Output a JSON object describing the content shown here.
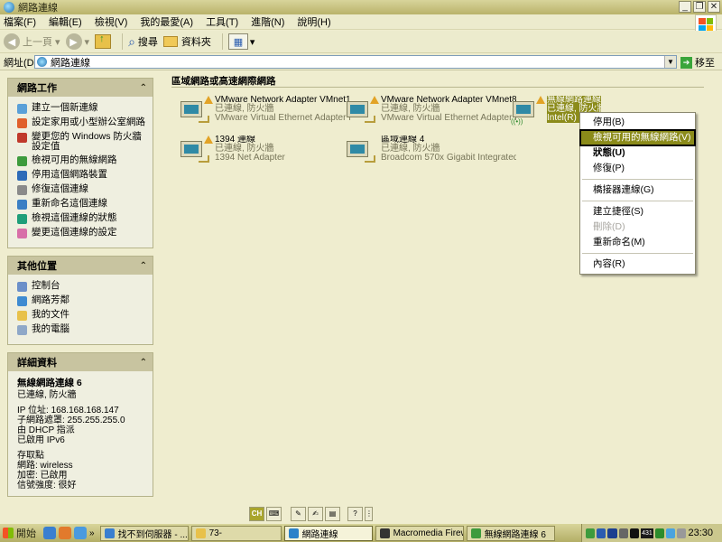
{
  "window": {
    "title": "網路連線",
    "controls": [
      "_",
      "❐",
      "✕"
    ]
  },
  "menu": [
    "檔案(F)",
    "編輯(E)",
    "檢視(V)",
    "我的最愛(A)",
    "工具(T)",
    "進階(N)",
    "說明(H)"
  ],
  "toolbar": {
    "back": "上一頁",
    "search": "搜尋",
    "folders": "資料夾"
  },
  "address": {
    "label": "網址(D)",
    "value": "網路連線",
    "go": "移至"
  },
  "network_tasks": {
    "title": "網路工作",
    "items": [
      "建立一個新連線",
      "設定家用或小型辦公室網路",
      "變更您的 Windows 防火牆設定值",
      "檢視可用的無線網路",
      "停用這個網路裝置",
      "修復這個連線",
      "重新命名這個連線",
      "檢視這個連線的狀態",
      "變更這個連線的設定"
    ]
  },
  "other_places": {
    "title": "其他位置",
    "items": [
      "控制台",
      "網路芳鄰",
      "我的文件",
      "我的電腦"
    ]
  },
  "details": {
    "title": "詳細資料",
    "name": "無線網路連線 6",
    "status": "已連線, 防火牆",
    "ip": "IP 位址: 168.168.168.147",
    "mask": "子網路遮罩: 255.255.255.0",
    "dhcp": "由 DHCP 指派",
    "ipv6": "已啟用 IPv6",
    "ap": "存取點",
    "network": "網路: wireless",
    "encryption": "加密: 已啟用",
    "signal": "信號強度: 很好"
  },
  "group_title": "區域網路或高速網際網路",
  "connections": [
    {
      "name": "VMware Network Adapter VMnet1",
      "status": "已連線, 防火牆",
      "device": "VMware Virtual Ethernet Adapter f..."
    },
    {
      "name": "VMware Network Adapter VMnet8",
      "status": "已連線, 防火牆",
      "device": "VMware Virtual Ethernet Adapter f..."
    },
    {
      "name": "無線網路連線 6",
      "status": "已連線, 防火牆",
      "device": "Intel(R) P..."
    },
    {
      "name": "1394 連線",
      "status": "已連線, 防火牆",
      "device": "1394 Net Adapter"
    },
    {
      "name": "區域連線 4",
      "status": "已連線, 防火牆",
      "device": "Broadcom 570x Gigabit Integrated ..."
    }
  ],
  "context_menu": [
    {
      "label": "停用(B)"
    },
    {
      "label": "檢視可用的無線網路(V)",
      "state": "highlighted"
    },
    {
      "label": "狀態(U)",
      "state": "bold"
    },
    {
      "label": "修復(P)"
    },
    {
      "sep": true
    },
    {
      "label": "橋接器連線(G)"
    },
    {
      "sep": true
    },
    {
      "label": "建立捷徑(S)"
    },
    {
      "label": "刪除(D)",
      "state": "disabled"
    },
    {
      "label": "重新命名(M)"
    },
    {
      "sep": true
    },
    {
      "label": "內容(R)"
    }
  ],
  "langbar": {
    "ch": "CH"
  },
  "taskbar": {
    "start": "開始",
    "tasks": [
      "找不到伺服器 - ...",
      "73-",
      "網路連線",
      "Macromedia Firew...",
      "無線網路連線 6"
    ],
    "tray_num": "431",
    "clock": "23:30"
  },
  "colors": {
    "accent": "#8b8b1a",
    "panel_head": "#c8c4a0",
    "content_bg": "#efedcf"
  }
}
